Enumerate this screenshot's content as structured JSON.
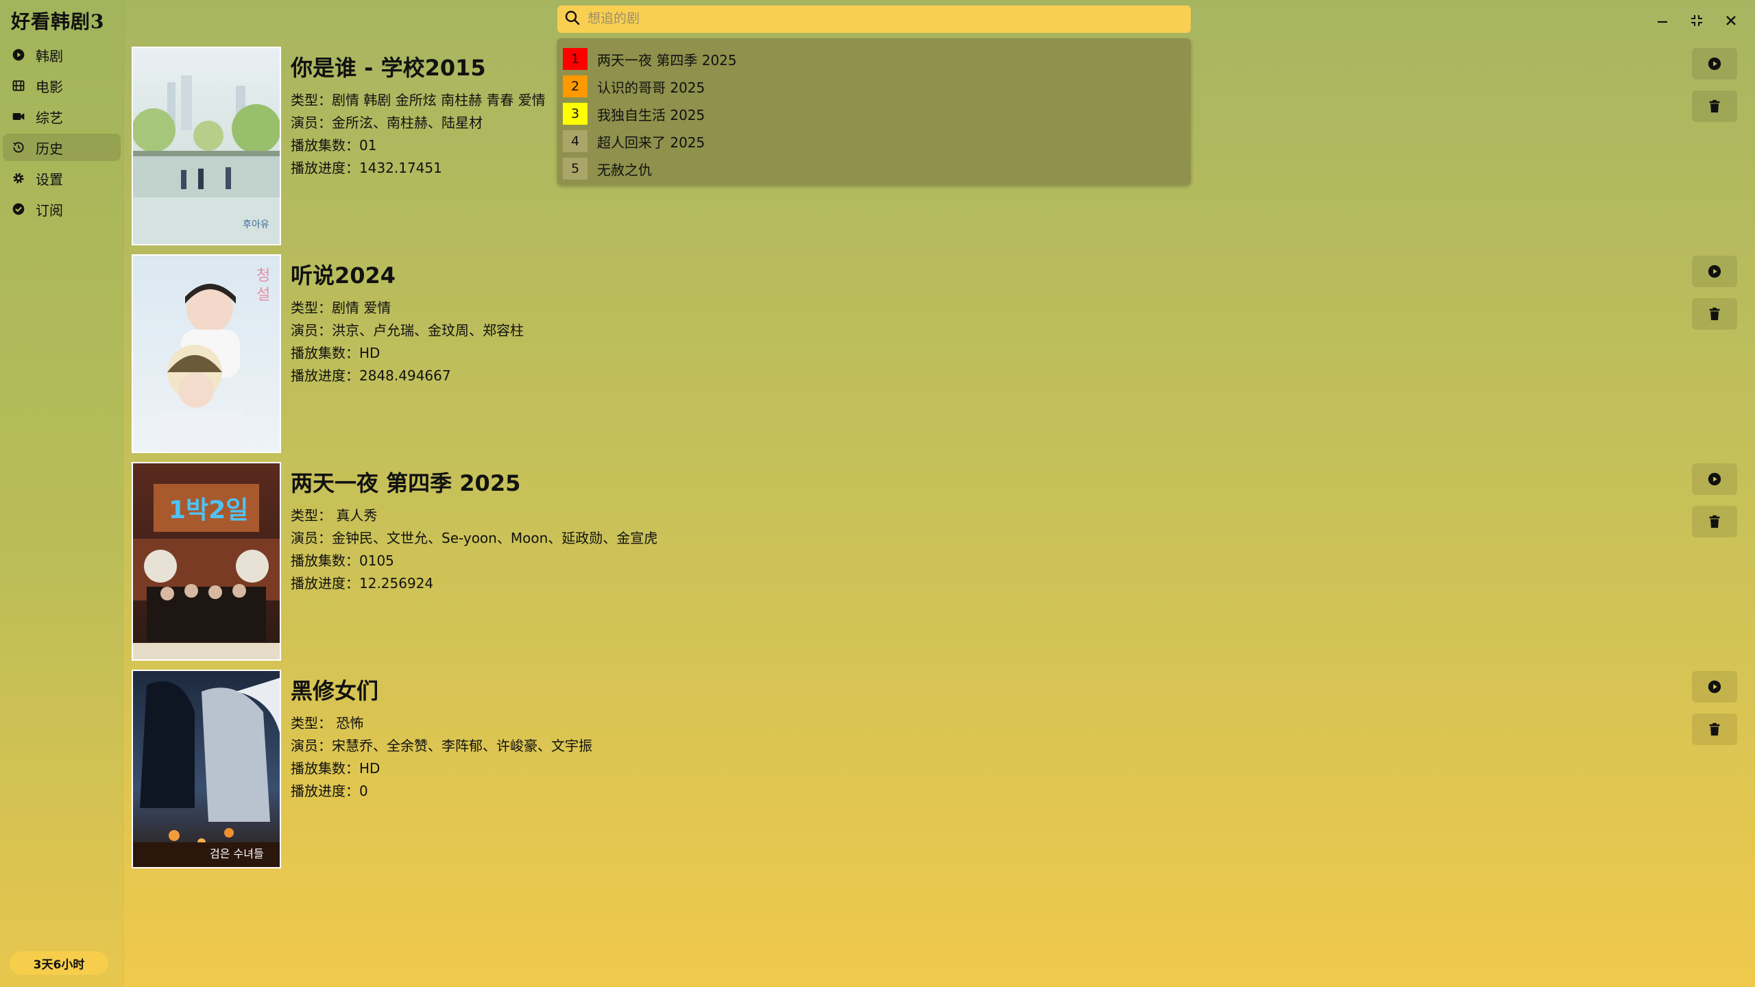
{
  "app": {
    "title": "好看韩剧3"
  },
  "sidebar": {
    "items": [
      {
        "label": "韩剧",
        "icon": "play-circle-icon"
      },
      {
        "label": "电影",
        "icon": "film-icon"
      },
      {
        "label": "综艺",
        "icon": "video-camera-icon"
      },
      {
        "label": "历史",
        "icon": "history-icon",
        "active": true
      },
      {
        "label": "设置",
        "icon": "gear-icon"
      },
      {
        "label": "订阅",
        "icon": "check-circle-icon"
      }
    ],
    "timer": "3天6小时"
  },
  "search": {
    "placeholder": "想追的剧",
    "value": "",
    "suggestions": [
      {
        "rank": "1",
        "text": "两天一夜 第四季 2025",
        "color": "#ff0000"
      },
      {
        "rank": "2",
        "text": "认识的哥哥 2025",
        "color": "#ff9900"
      },
      {
        "rank": "3",
        "text": "我独自生活 2025",
        "color": "#ffff00"
      },
      {
        "rank": "4",
        "text": "超人回来了 2025",
        "color": "#aaa66a"
      },
      {
        "rank": "5",
        "text": "无赦之仇",
        "color": "#aaa66a"
      }
    ]
  },
  "history": [
    {
      "title": "你是谁 - 学校2015",
      "genre": "类型：剧情 韩剧 金所炫 南柱赫 青春 爱情",
      "cast": "演员：金所泫、南柱赫、陆星材",
      "episodes": "播放集数：01",
      "progress": "播放进度：1432.17451"
    },
    {
      "title": "听说2024",
      "genre": "类型：剧情 爱情",
      "cast": "演员：洪京、卢允瑞、金玟周、郑容柱",
      "episodes": "播放集数：HD",
      "progress": "播放进度：2848.494667"
    },
    {
      "title": "两天一夜 第四季 2025",
      "genre": "类型： 真人秀",
      "cast": "演员：金钟民、文世允、Se-yoon、Moon、延政勋、金宣虎",
      "episodes": "播放集数：0105",
      "progress": "播放进度：12.256924"
    },
    {
      "title": "黑修女们",
      "genre": "类型： 恐怖",
      "cast": "演员：宋慧乔、全余赞、李阵郁、许峻豪、文宇振",
      "episodes": "播放集数：HD",
      "progress": "播放进度：0"
    }
  ]
}
